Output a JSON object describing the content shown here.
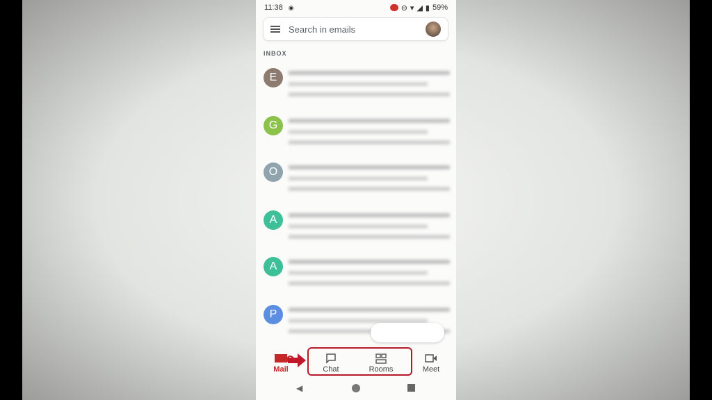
{
  "status": {
    "time": "11:38",
    "battery": "59%"
  },
  "search": {
    "placeholder": "Search in emails"
  },
  "inbox_label": "INBOX",
  "emails": [
    {
      "letter": "E",
      "color": "#8d7b70"
    },
    {
      "letter": "G",
      "color": "#8bc34a"
    },
    {
      "letter": "O",
      "color": "#90a4ae"
    },
    {
      "letter": "A",
      "color": "#3fbf98"
    },
    {
      "letter": "A",
      "color": "#3fbf98"
    },
    {
      "letter": "P",
      "color": "#5b8de0"
    }
  ],
  "nav": {
    "mail": "Mail",
    "mail_badge": "2",
    "chat": "Chat",
    "rooms": "Rooms",
    "meet": "Meet"
  },
  "colors": {
    "accent": "#c62828",
    "highlight": "#b5182b"
  }
}
